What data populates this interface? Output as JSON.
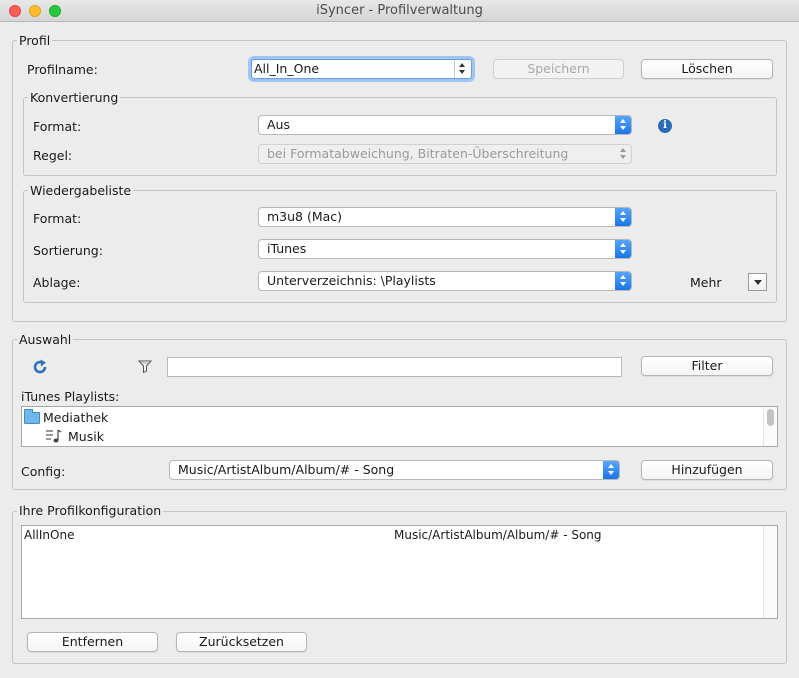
{
  "window": {
    "title": "iSyncer - Profilverwaltung"
  },
  "profil": {
    "group_title": "Profil",
    "name_label": "Profilname:",
    "name_value": "All_In_One",
    "save_label": "Speichern",
    "delete_label": "Löschen"
  },
  "konvertierung": {
    "group_title": "Konvertierung",
    "format_label": "Format:",
    "format_value": "Aus",
    "regel_label": "Regel:",
    "regel_value": "bei Formatabweichung, Bitraten-Überschreitung"
  },
  "wiedergabeliste": {
    "group_title": "Wiedergabeliste",
    "format_label": "Format:",
    "format_value": "m3u8 (Mac)",
    "sortierung_label": "Sortierung:",
    "sortierung_value": "iTunes",
    "ablage_label": "Ablage:",
    "ablage_value": "Unterverzeichnis: \\Playlists",
    "mehr_label": "Mehr"
  },
  "auswahl": {
    "group_title": "Auswahl",
    "filter_value": "",
    "filter_label": "Filter",
    "playlists_label": "iTunes Playlists:",
    "tree": [
      {
        "label": "Mediathek",
        "icon": "folder-icon"
      },
      {
        "label": "Musik",
        "icon": "music-list-icon"
      }
    ],
    "config_label": "Config:",
    "config_value": "Music/ArtistAlbum/Album/# - Song",
    "add_label": "Hinzufügen"
  },
  "profilkonfiguration": {
    "group_title": "Ihre Profilkonfiguration",
    "rows": [
      {
        "name": "AllInOne",
        "path": "Music/ArtistAlbum/Album/# - Song"
      }
    ],
    "remove_label": "Entfernen",
    "reset_label": "Zurücksetzen"
  },
  "colors": {
    "window_bg": "#ececec",
    "select_accent": "#1671e6",
    "focus_ring": "#9ec5f5",
    "info_icon": "#2a6db5",
    "refresh_icon": "#2f73c0",
    "folder_icon": "#6fb9ea"
  }
}
